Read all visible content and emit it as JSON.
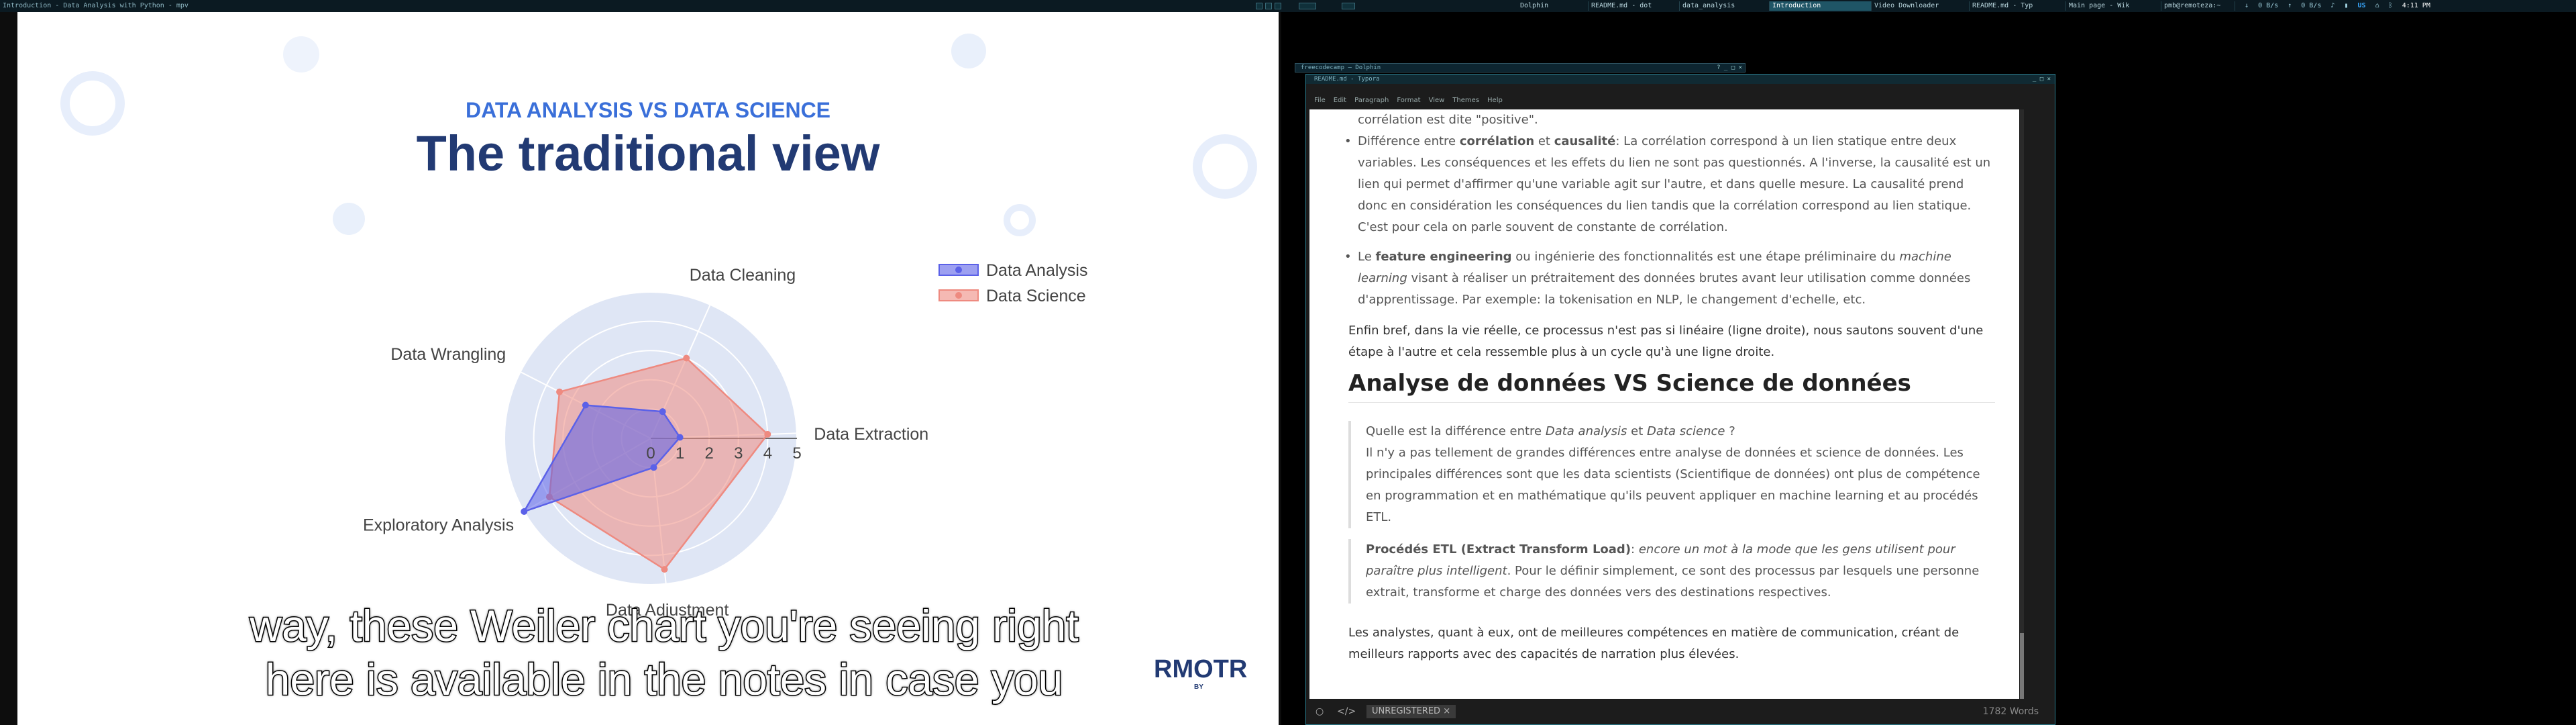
{
  "topbar": {
    "mpv_title": "Introduction - Data Analysis with Python - mpv",
    "tasks": [
      {
        "label": "Dolphin",
        "active": false
      },
      {
        "label": "README.md - dot",
        "active": false
      },
      {
        "label": "data_analysis",
        "active": false
      },
      {
        "label": "Introduction",
        "active": true
      },
      {
        "label": "Video Downloader",
        "active": false
      },
      {
        "label": "README.md - Typ",
        "active": false
      },
      {
        "label": "Main page - Wik",
        "active": false
      },
      {
        "label": "pmb@remoteza:~",
        "active": false
      }
    ],
    "net_down": "0 B/s",
    "net_up": "0 B/s",
    "keyboard_layout": "US",
    "clock": "4:11 PM"
  },
  "slide": {
    "kicker": "DATA ANALYSIS VS DATA SCIENCE",
    "title": "The traditional view"
  },
  "chart_data": {
    "type": "radar",
    "axes": [
      "Data Cleaning",
      "Data Extraction",
      "Data Adjustment",
      "Exploratory Analysis",
      "Data Wrangling"
    ],
    "radial_ticks": [
      "0",
      "1",
      "2",
      "3",
      "4",
      "5"
    ],
    "rlim": [
      0,
      5
    ],
    "series": [
      {
        "name": "Data Analysis",
        "color": "#5b61e8",
        "values": [
          1.0,
          1.0,
          1.0,
          5.0,
          2.5
        ]
      },
      {
        "name": "Data Science",
        "color": "#ee8a80",
        "values": [
          3.0,
          4.0,
          4.5,
          4.0,
          3.5
        ]
      }
    ],
    "legend": "top-right"
  },
  "subtitles": {
    "line1": "way, these Weiler chart you're seeing right",
    "line2": "here is available in the notes in case you"
  },
  "logo": {
    "name": "RMOTR",
    "by": "BY"
  },
  "dolphin": {
    "title": "freecodecamp — Dolphin"
  },
  "typora": {
    "title": "README.md - Typora",
    "menu": [
      "File",
      "Edit",
      "Paragraph",
      "Format",
      "View",
      "Themes",
      "Help"
    ],
    "doc": {
      "frag_top": "corrélation est dite \"positive\".",
      "b1_pre": "Différence entre ",
      "b1_k1": "corrélation",
      "b1_mid": " et ",
      "b1_k2": "causalité",
      "b1_rest": ": La corrélation correspond à un lien statique entre deux variables. Les conséquences et les effets du lien ne sont pas questionnés. A l'inverse, la causalité est un lien qui permet d'affirmer qu'une variable agit sur l'autre, et dans quelle mesure. La causalité prend donc en considération les conséquences du lien tandis que la corrélation correspond au lien statique. C'est pour cela on parle souvent de constante de corrélation.",
      "b2_pre": "Le ",
      "b2_k": "feature engineering",
      "b2_mid": " ou ingénierie des fonctionnalités est une étape préliminaire du ",
      "b2_i": "machine learning",
      "b2_rest": " visant à réaliser un prétraitement des données brutes avant leur utilisation comme données d'apprentissage. Par exemple: la tokenisation en NLP, le changement d'echelle, etc.",
      "para1": "Enfin bref, dans la vie réelle, ce processus n'est pas si linéaire (ligne droite), nous sautons souvent d'une étape à l'autre et cela ressemble plus à un cycle qu'à une ligne droite.",
      "h2": "Analyse de données VS Science de données",
      "q1_pre": "Quelle est la différence entre ",
      "q1_i1": "Data analysis",
      "q1_mid": " et ",
      "q1_i2": "Data science",
      "q1_end": " ?",
      "q1_body": "Il n'y a pas tellement de grandes différences entre analyse de données et science de données. Les principales différences sont que les data scientists (Scientifique de données) ont plus de compétence en programmation et en mathématique qu'ils peuvent appliquer en machine learning et au procédés ETL.",
      "q2_k": "Procédés ETL (Extract Transform Load)",
      "q2_colon": ": ",
      "q2_i": "encore un mot à la mode que les gens utilisent pour paraître plus intelligent",
      "q2_rest": ". Pour le définir simplement, ce sont des processus par lesquels une personne extrait, transforme et charge des données vers des destinations respectives.",
      "para2": "Les analystes, quant à eux, ont de meilleures compétences en matière de communication, créant de meilleurs rapports avec des capacités de narration plus élevées."
    },
    "status": {
      "unregistered": "UNREGISTERED ×",
      "word_count": "1782 Words"
    }
  }
}
